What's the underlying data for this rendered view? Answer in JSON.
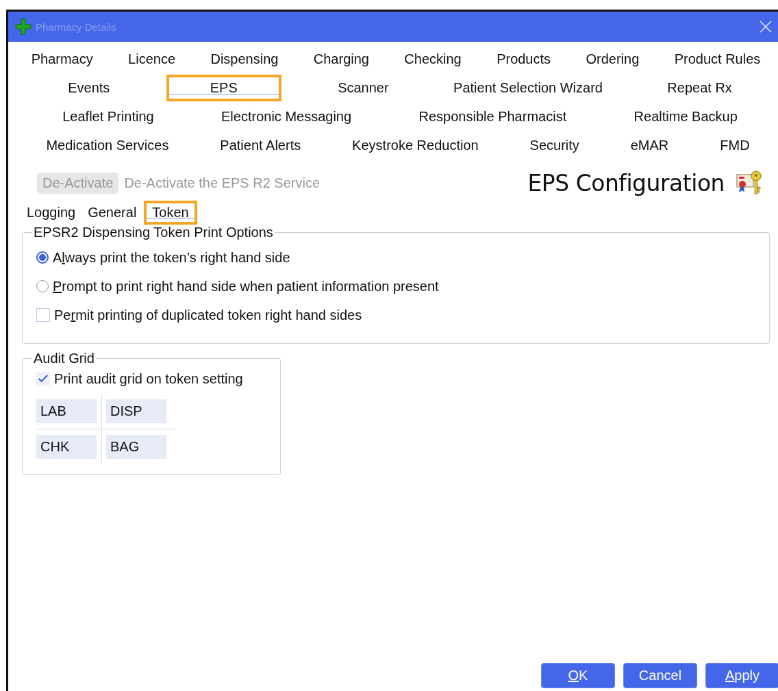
{
  "window": {
    "title": "Pharmacy Details"
  },
  "tab_rows": [
    [
      {
        "label": "Pharmacy",
        "selected": false,
        "highlighted": false
      },
      {
        "label": "Licence",
        "selected": false,
        "highlighted": false
      },
      {
        "label": "Dispensing",
        "selected": false,
        "highlighted": false
      },
      {
        "label": "Charging",
        "selected": false,
        "highlighted": false
      },
      {
        "label": "Checking",
        "selected": false,
        "highlighted": false
      },
      {
        "label": "Products",
        "selected": false,
        "highlighted": false
      },
      {
        "label": "Ordering",
        "selected": false,
        "highlighted": false
      },
      {
        "label": "Product Rules",
        "selected": false,
        "highlighted": false
      }
    ],
    [
      {
        "label": "Events",
        "selected": false,
        "highlighted": false
      },
      {
        "label": "EPS",
        "selected": true,
        "highlighted": true
      },
      {
        "label": "Scanner",
        "selected": false,
        "highlighted": false
      },
      {
        "label": "Patient Selection Wizard",
        "selected": false,
        "highlighted": false
      },
      {
        "label": "Repeat Rx",
        "selected": false,
        "highlighted": false
      }
    ],
    [
      {
        "label": "Leaflet Printing",
        "selected": false,
        "highlighted": false
      },
      {
        "label": "Electronic Messaging",
        "selected": false,
        "highlighted": false
      },
      {
        "label": "Responsible Pharmacist",
        "selected": false,
        "highlighted": false
      },
      {
        "label": "Realtime Backup",
        "selected": false,
        "highlighted": false
      }
    ],
    [
      {
        "label": "Medication Services",
        "selected": false,
        "highlighted": false
      },
      {
        "label": "Patient Alerts",
        "selected": false,
        "highlighted": false
      },
      {
        "label": "Keystroke Reduction",
        "selected": false,
        "highlighted": false
      },
      {
        "label": "Security",
        "selected": false,
        "highlighted": false
      },
      {
        "label": "eMAR",
        "selected": false,
        "highlighted": false
      },
      {
        "label": "FMD",
        "selected": false,
        "highlighted": false
      }
    ]
  ],
  "service": {
    "button": "De-Activate",
    "disabled": true,
    "description": "De-Activate the EPS R2 Service"
  },
  "heading": "EPS Configuration",
  "sub_tabs": [
    {
      "label": "Logging",
      "selected": false,
      "highlighted": false
    },
    {
      "label": "General",
      "selected": false,
      "highlighted": false
    },
    {
      "label": "Token",
      "selected": true,
      "highlighted": true
    }
  ],
  "print_options": {
    "title": "EPSR2 Dispensing Token Print Options",
    "items": [
      {
        "kind": "radio",
        "before": "A",
        "key": "l",
        "after": "ways print the token’s right hand side",
        "checked": true
      },
      {
        "kind": "radio",
        "key": "P",
        "after": "rompt to print right hand side when patient information present",
        "checked": false
      },
      {
        "kind": "checkbox",
        "before": "Pe",
        "key": "r",
        "after": "mit printing of duplicated token right hand sides",
        "checked": false
      }
    ]
  },
  "audit_grid": {
    "title": "Audit Grid",
    "option": {
      "label": "Print audit grid on token setting",
      "checked": true
    },
    "cells": [
      "LAB",
      "DISP",
      "CHK",
      "BAG"
    ]
  },
  "buttons": [
    {
      "key": "O",
      "after": "K"
    },
    {
      "before": "Cancel"
    },
    {
      "key": "A",
      "after": "pply"
    }
  ]
}
